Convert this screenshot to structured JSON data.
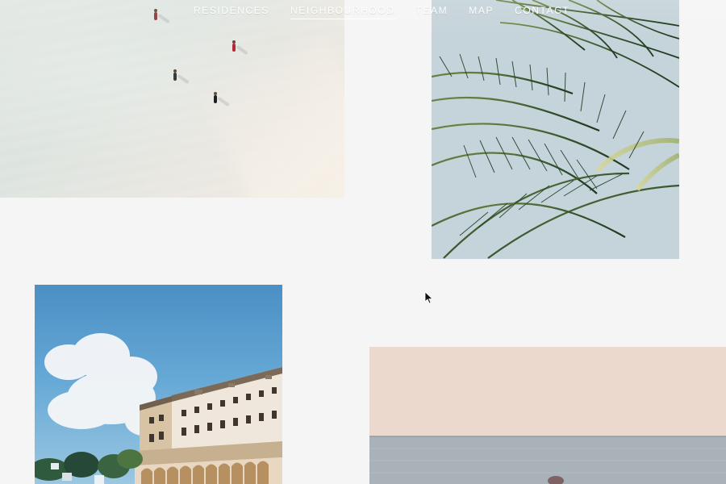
{
  "nav": {
    "items": [
      {
        "label": "RESIDENCES",
        "active": false
      },
      {
        "label": "NEIGHBOURHOOD",
        "active": true
      },
      {
        "label": "TEAM",
        "active": false
      },
      {
        "label": "MAP",
        "active": false
      },
      {
        "label": "CONTACT",
        "active": false
      }
    ]
  },
  "icons": {
    "cursor": "arrow-cursor-icon"
  },
  "colors": {
    "background": "#f5f5f5",
    "nav_text": "#ffffff"
  }
}
